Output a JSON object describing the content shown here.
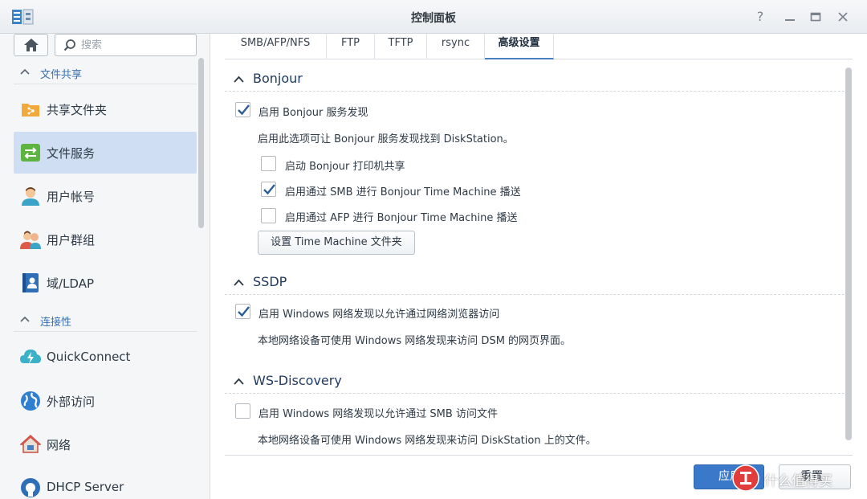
{
  "window": {
    "title": "控制面板"
  },
  "sidebar": {
    "search_placeholder": "搜索",
    "groups": [
      {
        "label": "文件共享"
      },
      {
        "label": "连接性"
      }
    ],
    "items": [
      {
        "label": "共享文件夹",
        "icon": "shared-folder-icon"
      },
      {
        "label": "文件服务",
        "icon": "file-services-icon",
        "active": true
      },
      {
        "label": "用户帐号",
        "icon": "user-icon"
      },
      {
        "label": "用户群组",
        "icon": "group-icon"
      },
      {
        "label": "域/LDAP",
        "icon": "domain-ldap-icon"
      },
      {
        "label": "QuickConnect",
        "icon": "quickconnect-icon"
      },
      {
        "label": "外部访问",
        "icon": "globe-icon"
      },
      {
        "label": "网络",
        "icon": "network-icon"
      },
      {
        "label": "DHCP Server",
        "icon": "dhcp-icon"
      }
    ]
  },
  "tabs": [
    {
      "label": "SMB/AFP/NFS"
    },
    {
      "label": "FTP"
    },
    {
      "label": "TFTP"
    },
    {
      "label": "rsync"
    },
    {
      "label": "高级设置",
      "active": true
    }
  ],
  "sections": {
    "bonjour": {
      "title": "Bonjour",
      "enable_label": "启用 Bonjour 服务发现",
      "enable_checked": true,
      "description": "启用此选项可让 Bonjour 服务发现找到 DiskStation。",
      "options": [
        {
          "label": "启动 Bonjour 打印机共享",
          "checked": false
        },
        {
          "label": "启用通过 SMB 进行 Bonjour Time Machine 播送",
          "checked": true
        },
        {
          "label": "启用通过 AFP 进行 Bonjour Time Machine 播送",
          "checked": false
        }
      ],
      "button_label": "设置 Time Machine 文件夹"
    },
    "ssdp": {
      "title": "SSDP",
      "enable_label": "启用 Windows 网络发现以允许通过网络浏览器访问",
      "enable_checked": true,
      "description": "本地网络设备可使用 Windows 网络发现来访问 DSM 的网页界面。"
    },
    "wsd": {
      "title": "WS-Discovery",
      "enable_label": "启用 Windows 网络发现以允许通过 SMB 访问文件",
      "enable_checked": false,
      "description": "本地网络设备可使用 Windows 网络发现来访问 DiskStation 上的文件。"
    }
  },
  "footer": {
    "apply_label": "应用",
    "reset_label": "重置"
  },
  "watermark": {
    "text": "什么值得买"
  },
  "colors": {
    "accent": "#3a79c9",
    "active_nav": "#cfdef2",
    "check": "#2d5c96"
  }
}
